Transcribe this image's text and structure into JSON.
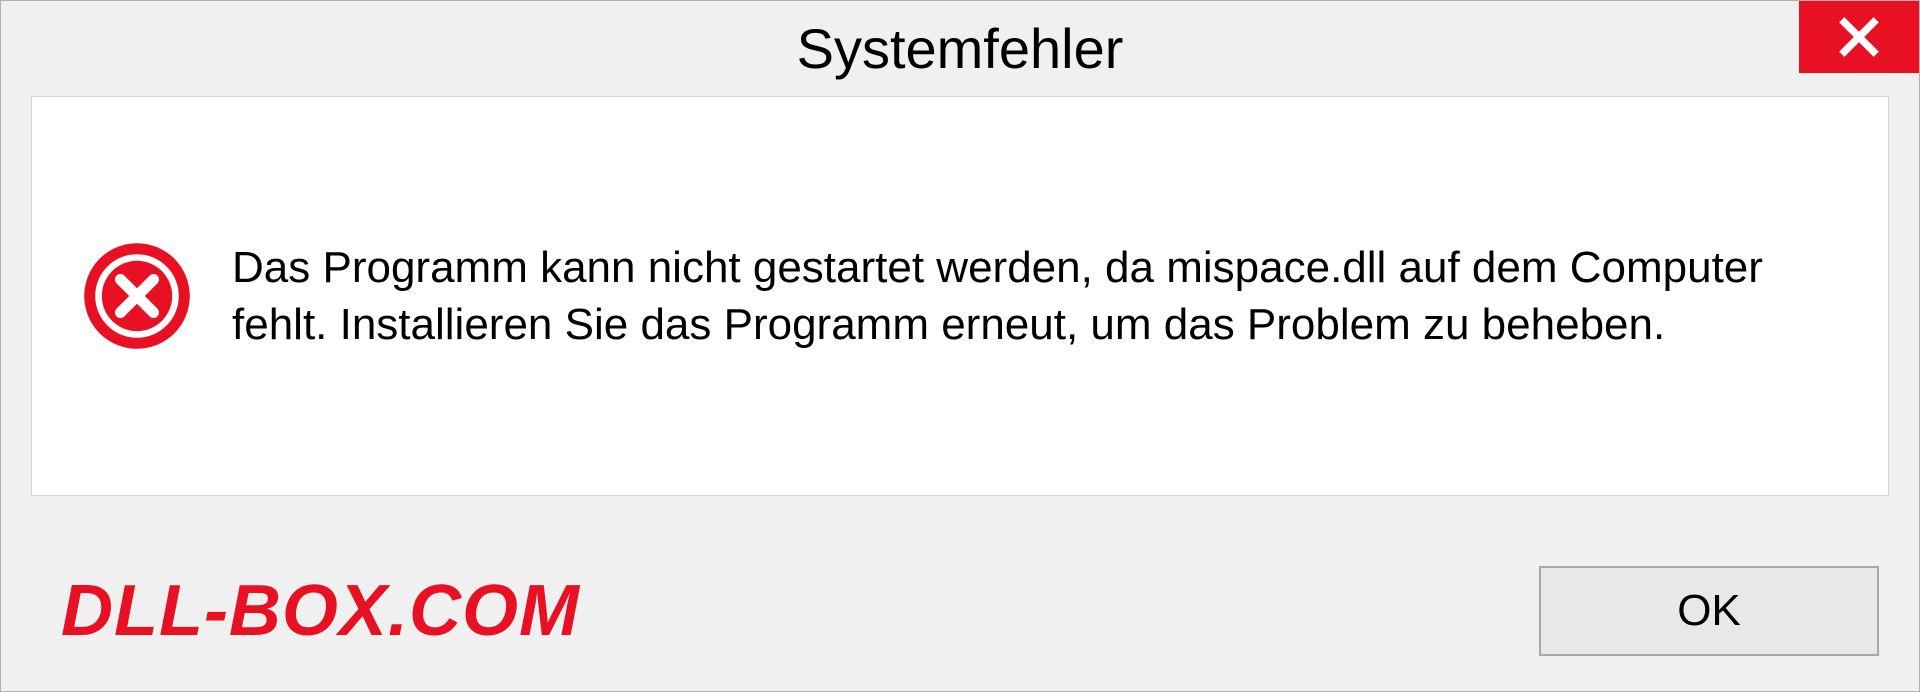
{
  "dialog": {
    "title": "Systemfehler",
    "message": "Das Programm kann nicht gestartet werden, da mispace.dll auf dem Computer fehlt. Installieren Sie das Programm erneut, um das Problem zu beheben.",
    "ok_label": "OK"
  },
  "watermark": "DLL-BOX.COM"
}
